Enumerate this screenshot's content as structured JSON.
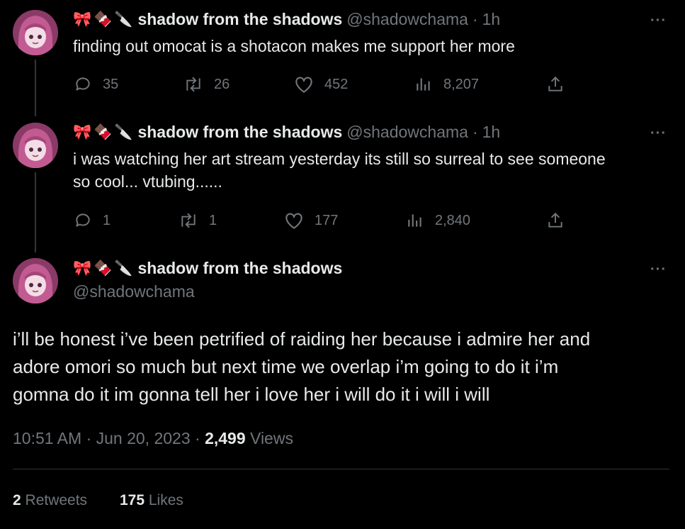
{
  "tweets": [
    {
      "display_name": "shadow from the shadows",
      "name_emojis": [
        "🎀",
        "🍫",
        "🔪"
      ],
      "handle": "@shadowchama",
      "time": "1h",
      "text_lines": [
        "finding out omocat is a shotacon makes me support her more"
      ],
      "replies": "35",
      "retweets": "26",
      "likes": "452",
      "views": "8,207"
    },
    {
      "display_name": "shadow from the shadows",
      "name_emojis": [
        "🎀",
        "🍫",
        "🔪"
      ],
      "handle": "@shadowchama",
      "time": "1h",
      "text_lines": [
        "i was watching her art stream yesterday its still so surreal to see someone",
        "so cool... vtubing......"
      ],
      "replies": "1",
      "retweets": "1",
      "likes": "177",
      "views": "2,840"
    }
  ],
  "main_tweet": {
    "display_name": "shadow from the shadows",
    "name_emojis": [
      "🎀",
      "🍫",
      "🔪"
    ],
    "handle": "@shadowchama",
    "text_lines": [
      "i’ll be honest i’ve been petrified of raiding her because i admire her and",
      "adore omori so much but next time we overlap i’m going to do it i’m",
      "gomna do it im gonna tell her i love her i will do it i will i will"
    ],
    "timestamp": "10:51 AM · Jun 20, 2023 · ",
    "views_count": "2,499",
    "views_label": " Views",
    "retweets_count": "2",
    "retweets_label": " Retweets",
    "likes_count": "175",
    "likes_label": " Likes"
  },
  "more_label": "···",
  "separator": "·"
}
